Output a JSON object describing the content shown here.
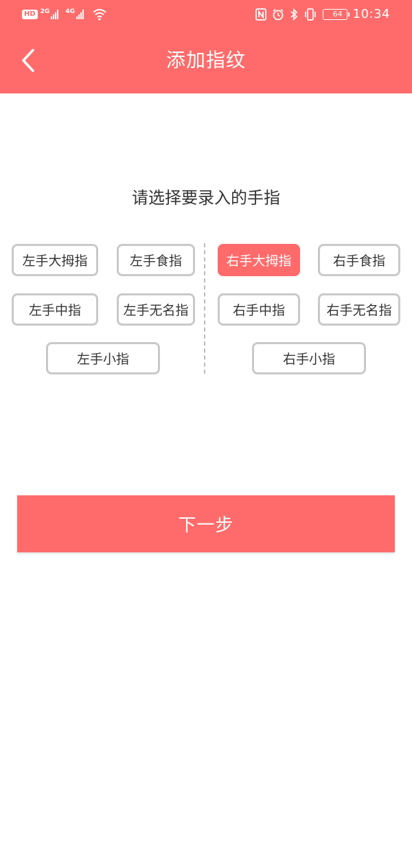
{
  "colors": {
    "accent": "#ff6b6b",
    "button_border": "#c9c9c9",
    "text": "#333333"
  },
  "status_bar": {
    "hd": "HD",
    "sim1_net": "2G",
    "sim2_net": "4G",
    "battery": "64",
    "time": "10:34",
    "icons": [
      "nfc-icon",
      "alarm-icon",
      "bluetooth-icon",
      "vibrate-icon",
      "battery-icon"
    ]
  },
  "header": {
    "title": "添加指纹",
    "back_icon": "chevron-left-icon"
  },
  "prompt": "请选择要录入的手指",
  "fingers": {
    "left": {
      "thumb": "左手大拇指",
      "index": "左手食指",
      "middle": "左手中指",
      "ring": "左手无名指",
      "little": "左手小指"
    },
    "right": {
      "thumb": "右手大拇指",
      "index": "右手食指",
      "middle": "右手中指",
      "ring": "右手无名指",
      "little": "右手小指"
    },
    "selected": "右手大拇指"
  },
  "next_button": "下一步"
}
